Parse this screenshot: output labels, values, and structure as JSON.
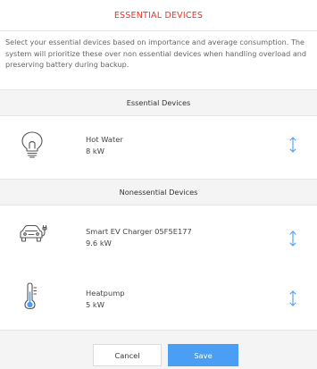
{
  "dialog": {
    "title": "ESSENTIAL DEVICES",
    "description": "Select your essential devices based on importance and average consumption. The system will prioritize these over non essential devices when handling overload and preserving battery during backup.",
    "accent_color": "#e6332a"
  },
  "essential": {
    "header": "Essential Devices",
    "devices": [
      {
        "name": "Hot Water",
        "power": "8 kW",
        "icon": "lightbulb-icon"
      }
    ]
  },
  "nonessential": {
    "header": "Nonessential Devices",
    "devices": [
      {
        "name": "Smart EV Charger 05F5E177",
        "power": "9.6 kW",
        "icon": "ev-charger-icon"
      },
      {
        "name": "Heatpump",
        "power": "5 kW",
        "icon": "thermometer-icon"
      }
    ]
  },
  "footer": {
    "cancel_label": "Cancel",
    "save_label": "Save",
    "save_color": "#4a9ff5"
  },
  "handle_color": "#4a9ff5"
}
